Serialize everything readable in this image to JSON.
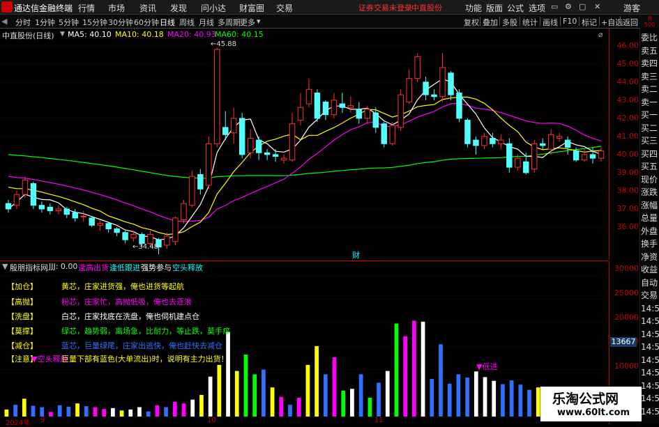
{
  "app": {
    "title": "通达信金融终端"
  },
  "menu": [
    "行情",
    "市场",
    "资讯",
    "发现",
    "问小达",
    "财富圈",
    "交易"
  ],
  "status": {
    "login_text": "证券交易未登录",
    "stock_name": "中直股份"
  },
  "menu_right": [
    "功能",
    "版面",
    "公式",
    "选项",
    "游客"
  ],
  "toolbar": {
    "periods": [
      "分时",
      "1分钟",
      "5分钟",
      "15分钟",
      "30分钟",
      "60分钟",
      "日线",
      "周线",
      "月线",
      "多周期",
      "更多"
    ],
    "active_period": "日线",
    "tools": [
      "复权",
      "叠加",
      "多股",
      "统计",
      "画线",
      "F10",
      "标记",
      "+自选",
      "返回"
    ]
  },
  "main_chart": {
    "title": "中直股份(日线)",
    "ma": [
      {
        "label": "MA5: 40.10",
        "color": "#ffffff"
      },
      {
        "label": "MA10: 40.18",
        "color": "#ffff00"
      },
      {
        "label": "MA20: 40.93",
        "color": "#ff00ff"
      },
      {
        "label": "MA60: 40.15",
        "color": "#00ff00"
      }
    ],
    "high_label": "45.88",
    "low_label": "34.48",
    "event_label": "财"
  },
  "chart_data": {
    "type": "candlestick",
    "title": "中直股份(日线)",
    "ylim": [
      34.5,
      46.3
    ],
    "yticks": [
      46.0,
      45.0,
      44.0,
      43.0,
      42.0,
      41.0,
      40.0,
      39.0,
      38.0,
      37.0,
      36.0
    ],
    "candles": [
      [
        37.3,
        37.0,
        37.5,
        36.8
      ],
      [
        37.2,
        37.8,
        38.0,
        37.0
      ],
      [
        37.8,
        38.6,
        38.8,
        37.6
      ],
      [
        38.4,
        37.2,
        38.5,
        37.0
      ],
      [
        37.2,
        37.0,
        37.4,
        36.8
      ],
      [
        37.1,
        36.9,
        37.3,
        36.7
      ],
      [
        36.9,
        37.0,
        37.2,
        36.7
      ],
      [
        37.0,
        36.7,
        37.1,
        36.5
      ],
      [
        36.8,
        36.5,
        37.0,
        36.3
      ],
      [
        36.6,
        36.6,
        36.9,
        36.3
      ],
      [
        36.5,
        36.1,
        36.6,
        36.0
      ],
      [
        36.1,
        36.2,
        36.4,
        35.8
      ],
      [
        36.2,
        35.9,
        36.3,
        35.7
      ],
      [
        35.9,
        35.7,
        36.0,
        35.5
      ],
      [
        35.7,
        35.3,
        35.8,
        35.1
      ],
      [
        35.4,
        35.6,
        35.8,
        35.2
      ],
      [
        35.6,
        35.1,
        35.7,
        34.9
      ],
      [
        35.1,
        35.6,
        35.8,
        34.9
      ],
      [
        35.3,
        34.9,
        35.4,
        34.5
      ],
      [
        35.0,
        35.5,
        35.7,
        34.8
      ],
      [
        35.2,
        36.5,
        36.6,
        35.0
      ],
      [
        36.4,
        37.3,
        37.5,
        36.2
      ],
      [
        37.2,
        38.8,
        39.1,
        37.1
      ],
      [
        38.9,
        38.1,
        39.2,
        37.8
      ],
      [
        38.3,
        40.6,
        41.0,
        38.1
      ],
      [
        40.6,
        45.8,
        45.9,
        40.4
      ],
      [
        41.5,
        41.1,
        42.4,
        40.8
      ],
      [
        41.2,
        42.0,
        42.6,
        40.6
      ],
      [
        42.0,
        40.0,
        42.3,
        39.8
      ],
      [
        40.1,
        40.9,
        41.4,
        39.8
      ],
      [
        40.8,
        40.1,
        41.0,
        39.7
      ],
      [
        40.1,
        40.0,
        40.3,
        39.7
      ],
      [
        40.0,
        39.9,
        40.3,
        39.6
      ],
      [
        39.7,
        39.8,
        40.0,
        39.5
      ],
      [
        39.7,
        41.7,
        42.3,
        39.6
      ],
      [
        41.9,
        42.6,
        43.4,
        41.6
      ],
      [
        42.8,
        43.6,
        44.2,
        42.6
      ],
      [
        43.4,
        42.0,
        43.6,
        41.8
      ],
      [
        42.9,
        42.2,
        43.0,
        41.9
      ],
      [
        42.2,
        43.0,
        43.4,
        42.0
      ],
      [
        42.8,
        42.6,
        43.4,
        42.3
      ],
      [
        42.6,
        42.7,
        43.2,
        42.3
      ],
      [
        42.5,
        42.0,
        42.9,
        41.7
      ],
      [
        42.0,
        42.5,
        42.7,
        41.7
      ],
      [
        42.3,
        41.5,
        42.6,
        41.2
      ],
      [
        41.7,
        40.6,
        41.8,
        40.4
      ],
      [
        40.6,
        41.6,
        41.8,
        40.5
      ],
      [
        41.5,
        43.3,
        43.6,
        41.3
      ],
      [
        42.9,
        44.2,
        44.7,
        42.8
      ],
      [
        44.2,
        45.4,
        45.6,
        44.0
      ],
      [
        44.0,
        43.3,
        44.3,
        43.0
      ],
      [
        43.3,
        43.2,
        43.6,
        43.0
      ],
      [
        43.2,
        44.8,
        45.6,
        42.9
      ],
      [
        44.5,
        43.3,
        44.6,
        43.0
      ],
      [
        43.4,
        42.0,
        43.6,
        41.8
      ],
      [
        41.9,
        40.6,
        42.0,
        40.4
      ],
      [
        40.8,
        40.5,
        41.0,
        40.0
      ],
      [
        40.5,
        41.0,
        41.2,
        40.3
      ],
      [
        40.9,
        40.6,
        41.2,
        40.4
      ],
      [
        40.6,
        40.8,
        41.1,
        40.3
      ],
      [
        40.6,
        39.3,
        40.9,
        39.0
      ],
      [
        39.3,
        39.8,
        40.0,
        39.1
      ],
      [
        39.6,
        39.0,
        40.1,
        38.9
      ],
      [
        39.2,
        40.6,
        40.8,
        39.0
      ],
      [
        40.6,
        40.5,
        40.9,
        40.3
      ],
      [
        40.3,
        41.1,
        41.4,
        40.0
      ],
      [
        40.9,
        41.0,
        41.2,
        40.7
      ],
      [
        40.8,
        40.4,
        41.0,
        40.0
      ],
      [
        40.2,
        39.7,
        40.4,
        39.6
      ],
      [
        39.7,
        40.0,
        40.3,
        39.6
      ],
      [
        40.0,
        39.8,
        40.4,
        39.5
      ],
      [
        39.8,
        40.2,
        40.4,
        39.6
      ]
    ],
    "series": [
      {
        "name": "MA5",
        "color": "#ffffff"
      },
      {
        "name": "MA10",
        "color": "#ffff00"
      },
      {
        "name": "MA20",
        "color": "#ff00ff"
      },
      {
        "name": "MA60",
        "color": "#00ff00"
      }
    ],
    "x_ticks": [
      "2024年",
      "9",
      "10",
      "11"
    ]
  },
  "indicator": {
    "name": "殷朋指标网",
    "value": "JJJ: 0.00",
    "tags": [
      {
        "label": "逢高出货",
        "color": "#ff00ff"
      },
      {
        "label": "逢低跟进",
        "color": "#00ffff"
      },
      {
        "label": "强势参与",
        "color": "#ffffff"
      },
      {
        "label": "空头释放",
        "color": "#00ffff"
      }
    ],
    "notes": [
      {
        "tag": "【加仓】",
        "desc": "黄芯，庄家进货强，俺也进货等起航",
        "color": "#ffff00"
      },
      {
        "tag": "【高抛】",
        "desc": "粉芯，庄家忙，高抛低吸，俺也去逐浪",
        "color": "#ff00ff"
      },
      {
        "tag": "【洗盘】",
        "desc": "白芯，庄家找底在洗盘，俺也伺机建点仓",
        "color": "#ffffff"
      },
      {
        "tag": "【莫撑】",
        "desc": "绿芯，趋势弱，离场急，比耐力，等止跌，莫手痒",
        "color": "#00ff00"
      },
      {
        "tag": "【减仓】",
        "desc": "蓝芯，巨量绿尾，庄家出逃快，俺也赶快去减仓",
        "color": "#3070ff"
      },
      {
        "tag": "【注意】",
        "desc": "巨量下部有蓝色(大单流出)时，说明有主力出货！",
        "color": "#ffff00"
      }
    ],
    "signal_1": "▼空头释放",
    "signal_2": "▼低进",
    "vol_ticks": [
      "30000",
      "25000",
      "20000",
      "15000",
      "10000"
    ],
    "vol_current": "13667",
    "volume_data": [
      [
        1500,
        "#ffff00"
      ],
      [
        2500,
        "#3070ff"
      ],
      [
        3800,
        "#ffff00"
      ],
      [
        2300,
        "#3070ff"
      ],
      [
        2000,
        "#3070ff"
      ],
      [
        1000,
        "#ff00ff"
      ],
      [
        2400,
        "#3070ff"
      ],
      [
        2100,
        "#3070ff"
      ],
      [
        2800,
        "#ffff00"
      ],
      [
        2200,
        "#3070ff"
      ],
      [
        2000,
        "#ff00ff"
      ],
      [
        1600,
        "#ff00ff"
      ],
      [
        1800,
        "#ffffff"
      ],
      [
        1300,
        "#ffff00"
      ],
      [
        1500,
        "#ffffff"
      ],
      [
        2000,
        "#ffffff"
      ],
      [
        1100,
        "#3070ff"
      ],
      [
        2400,
        "#ff00ff"
      ],
      [
        2000,
        "#3070ff"
      ],
      [
        3100,
        "#ff00ff"
      ],
      [
        2800,
        "#ff00ff"
      ],
      [
        3600,
        "#ffffff"
      ],
      [
        4600,
        "#ffff00"
      ],
      [
        8500,
        "#ffffff"
      ],
      [
        11000,
        "#ffff00"
      ],
      [
        18000,
        "#ffffff"
      ],
      [
        9700,
        "#ffff00"
      ],
      [
        13200,
        "#00ff00"
      ],
      [
        9000,
        "#00ff00"
      ],
      [
        10000,
        "#3070ff"
      ],
      [
        6200,
        "#ffff00"
      ],
      [
        4200,
        "#ff00ff"
      ],
      [
        2500,
        "#3070ff"
      ],
      [
        4000,
        "#ff00ff"
      ],
      [
        11000,
        "#ffff00"
      ],
      [
        15000,
        "#ffff00"
      ],
      [
        9000,
        "#3070ff"
      ],
      [
        12600,
        "#ff00ff"
      ],
      [
        5500,
        "#00ff00"
      ],
      [
        5900,
        "#ffffff"
      ],
      [
        9000,
        "#3070ff"
      ],
      [
        4000,
        "#00ff00"
      ],
      [
        7200,
        "#3070ff"
      ],
      [
        9700,
        "#ffffff"
      ],
      [
        19800,
        "#00ff00"
      ],
      [
        17100,
        "#ff00ff"
      ],
      [
        20400,
        "#ff00ff"
      ],
      [
        20200,
        "#ffffff"
      ],
      [
        8000,
        "#3070ff"
      ],
      [
        15400,
        "#3070ff"
      ],
      [
        7000,
        "#3070ff"
      ],
      [
        9000,
        "#3070ff"
      ],
      [
        8300,
        "#3070ff"
      ],
      [
        9600,
        "#ffffff"
      ],
      [
        8400,
        "#ffffff"
      ],
      [
        7600,
        "#ffffff"
      ],
      [
        6900,
        "#3070ff"
      ],
      [
        7700,
        "#3070ff"
      ],
      [
        6800,
        "#3070ff"
      ],
      [
        5700,
        "#3070ff"
      ],
      [
        6200,
        "#ffff00"
      ],
      [
        5400,
        "#ffff00"
      ],
      [
        4200,
        "#ff00ff"
      ],
      [
        6200,
        "#3070ff"
      ],
      [
        5200,
        "#ffffff"
      ],
      [
        4300,
        "#ffffff"
      ],
      [
        3700,
        "#3070ff"
      ],
      [
        2800,
        "#3070ff"
      ]
    ]
  },
  "right_panel": [
    "委比",
    "卖五",
    "卖四",
    "卖三",
    "卖二",
    "卖一",
    "买一",
    "买二",
    "买三",
    "买四",
    "买五",
    "现价",
    "涨跌",
    "涨幅",
    "总量",
    "外盘",
    "换手",
    "净资",
    "收益",
    "自动",
    "交易",
    "14:5",
    "14:5",
    "14:5",
    "14:5",
    "14:5",
    "14:5",
    "14:5",
    "14:5",
    "14:5"
  ],
  "right_header": {
    "r": "R",
    "num": "500"
  },
  "watermark": {
    "line1": "乐淘公式网",
    "line2": "www.60lt.com"
  }
}
